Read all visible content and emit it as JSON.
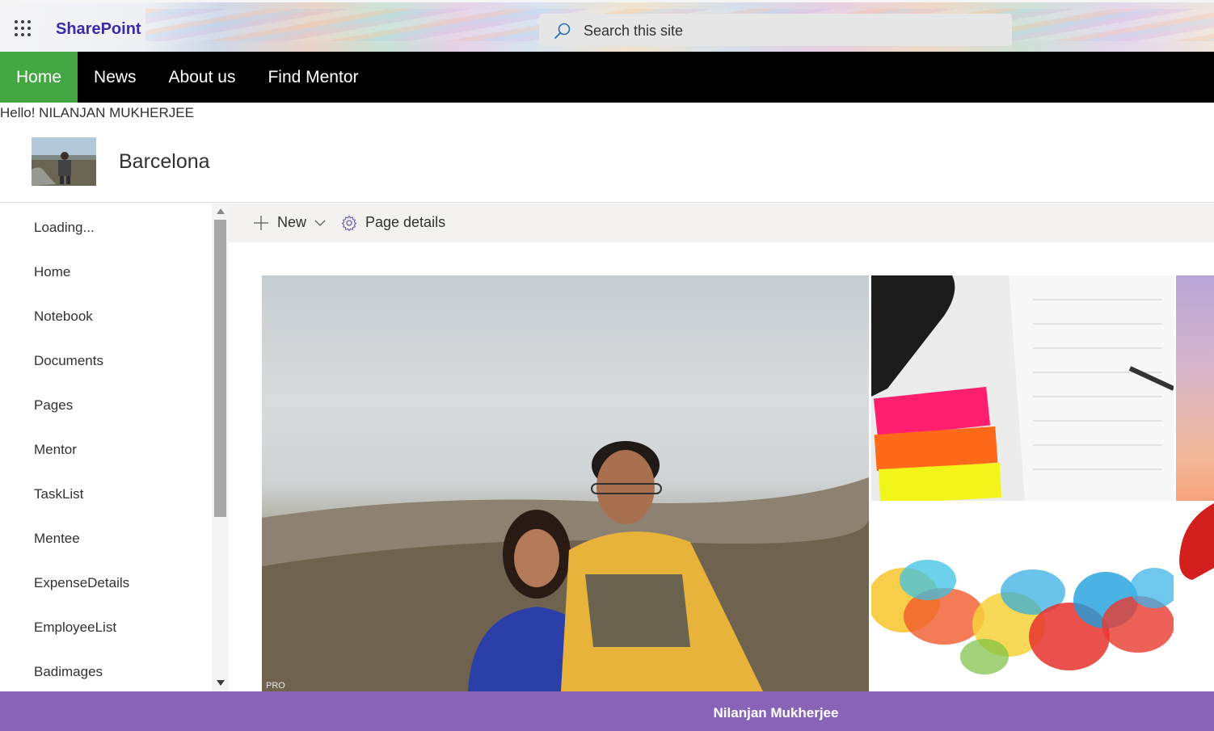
{
  "suitebar": {
    "app_name": "SharePoint",
    "search_placeholder": "Search this site"
  },
  "topnav": {
    "items": [
      {
        "label": "Home",
        "active": true
      },
      {
        "label": "News",
        "active": false
      },
      {
        "label": "About us",
        "active": false
      },
      {
        "label": "Find Mentor",
        "active": false
      }
    ],
    "active_color": "#44a744"
  },
  "greeting": "Hello! NILANJAN MUKHERJEE",
  "site": {
    "title": "Barcelona"
  },
  "leftnav": {
    "items": [
      {
        "label": "Loading..."
      },
      {
        "label": "Home"
      },
      {
        "label": "Notebook"
      },
      {
        "label": "Documents"
      },
      {
        "label": "Pages"
      },
      {
        "label": "Mentor"
      },
      {
        "label": "TaskList"
      },
      {
        "label": "Mentee"
      },
      {
        "label": "ExpenseDetails"
      },
      {
        "label": "EmployeeList"
      },
      {
        "label": "Badimages"
      }
    ]
  },
  "commandbar": {
    "new_label": "New",
    "details_label": "Page details"
  },
  "hero": {
    "watermark": "PRO"
  },
  "footer": {
    "name": "Nilanjan Mukherjee",
    "color": "#8764b8"
  }
}
